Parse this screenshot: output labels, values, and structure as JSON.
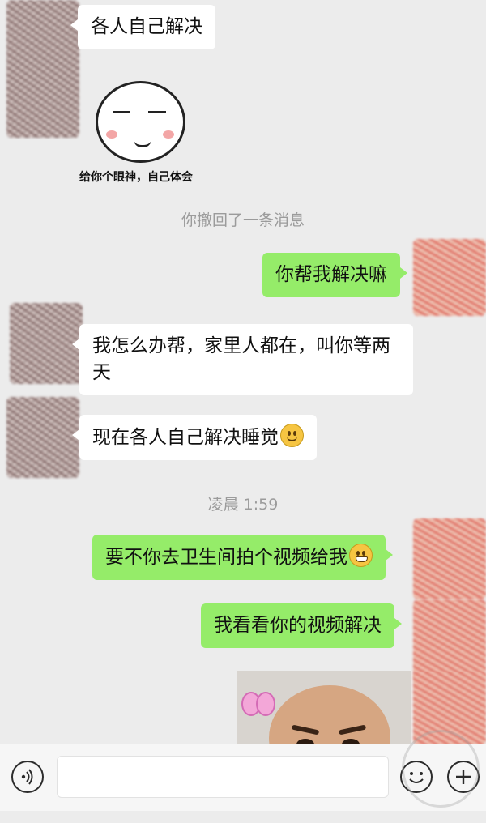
{
  "messages": {
    "m1": "各人自己解决",
    "sticker1_caption": "给你个眼神，自己体会",
    "recall_notice": "你撤回了一条消息",
    "m2": "你帮我解决嘛",
    "m3": "我怎么办帮，家里人都在，叫你等两天",
    "m4": "现在各人自己解决睡觉",
    "timestamp": "凌晨 1:59",
    "m5": "要不你去卫生间拍个视频给我",
    "m6": "我看看你的视频解决"
  },
  "icons": {
    "voice": "voice-input-icon",
    "emoji_button": "emoji-icon",
    "plus_button": "plus-icon",
    "smile_emoji": "smile-emoji-icon",
    "grin_emoji": "grin-emoji-icon"
  },
  "colors": {
    "background": "#ececec",
    "bubble_left": "#ffffff",
    "bubble_right": "#95ec69",
    "system_text": "#9b9b9b"
  }
}
